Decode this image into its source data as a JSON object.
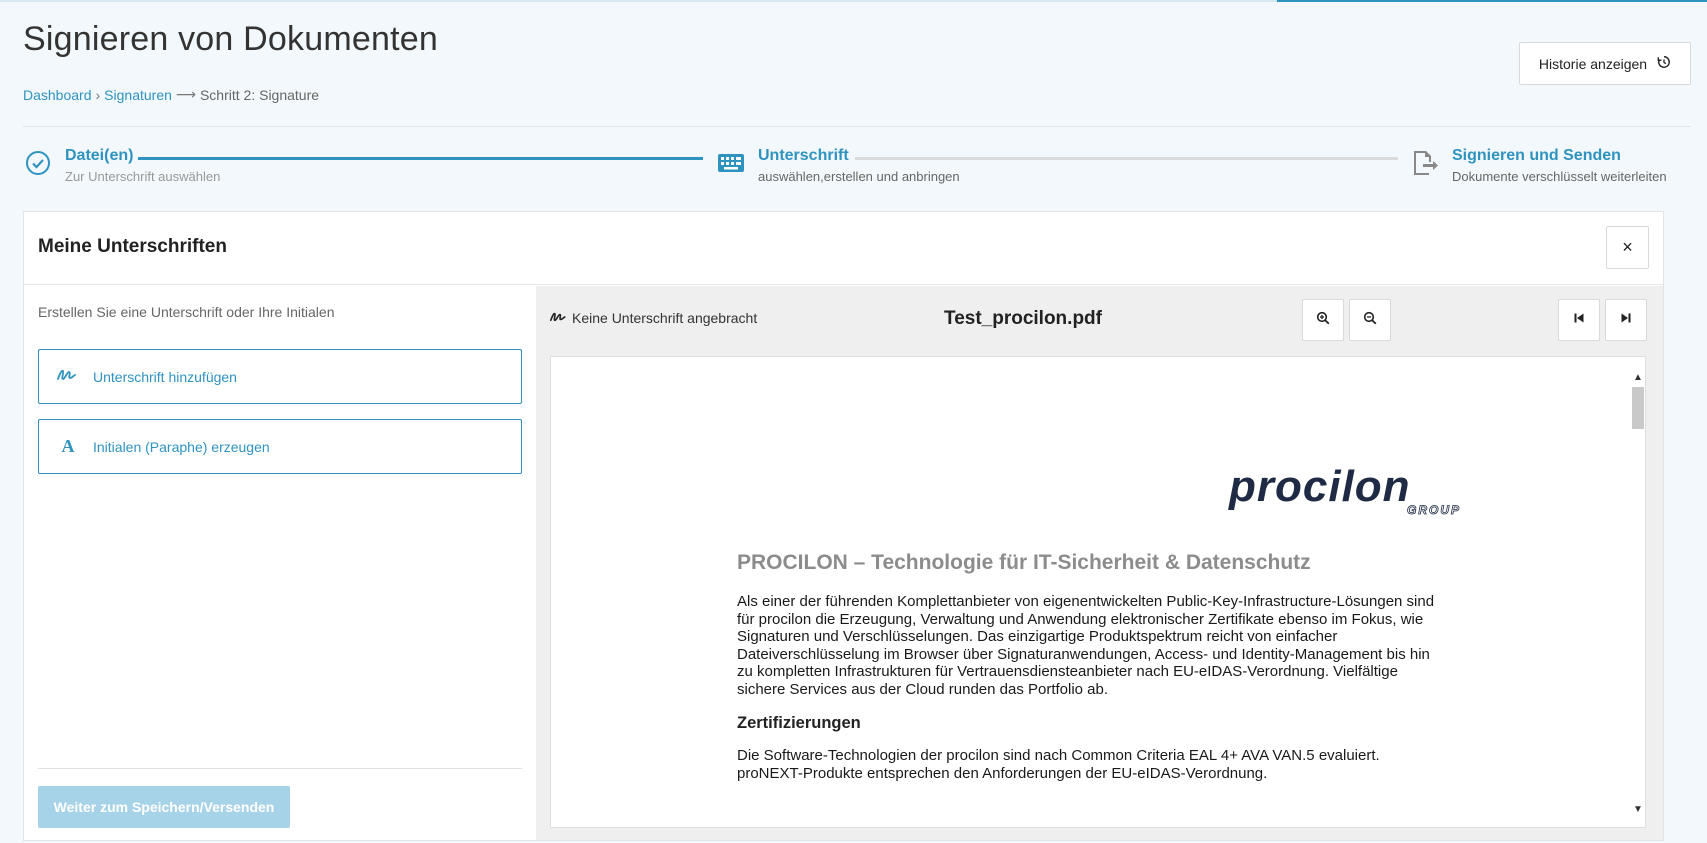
{
  "page": {
    "title": "Signieren von Dokumenten",
    "history_button": "Historie anzeigen"
  },
  "breadcrumb": {
    "items": [
      "Dashboard",
      "Signaturen"
    ],
    "current": "Schritt 2: Signature"
  },
  "stepper": {
    "steps": [
      {
        "title": "Datei(en)",
        "subtitle": "Zur Unterschrift auswählen",
        "state": "done"
      },
      {
        "title": "Unterschrift",
        "subtitle": "auswählen,erstellen und anbringen",
        "state": "active"
      },
      {
        "title": "Signieren und Senden",
        "subtitle": "Dokumente verschlüsselt weiterleiten",
        "state": "pending"
      }
    ]
  },
  "panel": {
    "title": "Meine Unterschriften",
    "close_label": "×",
    "left": {
      "hint": "Erstellen Sie eine Unterschrift oder Ihre Initialen",
      "add_signature": "Unterschrift hinzufügen",
      "create_initials": "Initialen (Paraphe) erzeugen",
      "continue": "Weiter zum Speichern/Versenden"
    },
    "viewer": {
      "signature_status": "Keine Unterschrift angebracht",
      "filename": "Test_procilon.pdf"
    }
  },
  "document": {
    "logo_text": "procilon",
    "logo_sub": "GROUP",
    "heading": "PROCILON – Technologie für IT-Sicherheit & Datenschutz",
    "paragraph_lines": [
      "Als einer der führenden Komplettanbieter von eigenentwickelten Public-Key-Infrastructure-Lösungen sind",
      "für procilon die Erzeugung, Verwaltung und Anwendung elektronischer Zertifikate ebenso im Fokus, wie",
      "Signaturen und Verschlüsselungen. Das einzigartige Produktspektrum reicht von einfacher",
      "Dateiverschlüsselung im Browser über Signaturanwendungen, Access- und Identity-Management bis hin",
      "zu kompletten Infrastrukturen für Vertrauensdiensteanbieter nach EU-eIDAS-Verordnung. Vielfältige",
      "sichere Services aus der Cloud runden das Portfolio ab."
    ],
    "subheading": "Zertifizierungen",
    "paragraph2_lines": [
      "Die Software-Technologien der procilon sind nach Common Criteria EAL 4+ AVA VAN.5 evaluiert.",
      "proNEXT-Produkte entsprechen den Anforderungen der EU-eIDAS-Verordnung."
    ]
  },
  "colors": {
    "accent": "#2f93c0",
    "logo": "#1f2a44",
    "disabled_button": "#a7d3e8"
  }
}
